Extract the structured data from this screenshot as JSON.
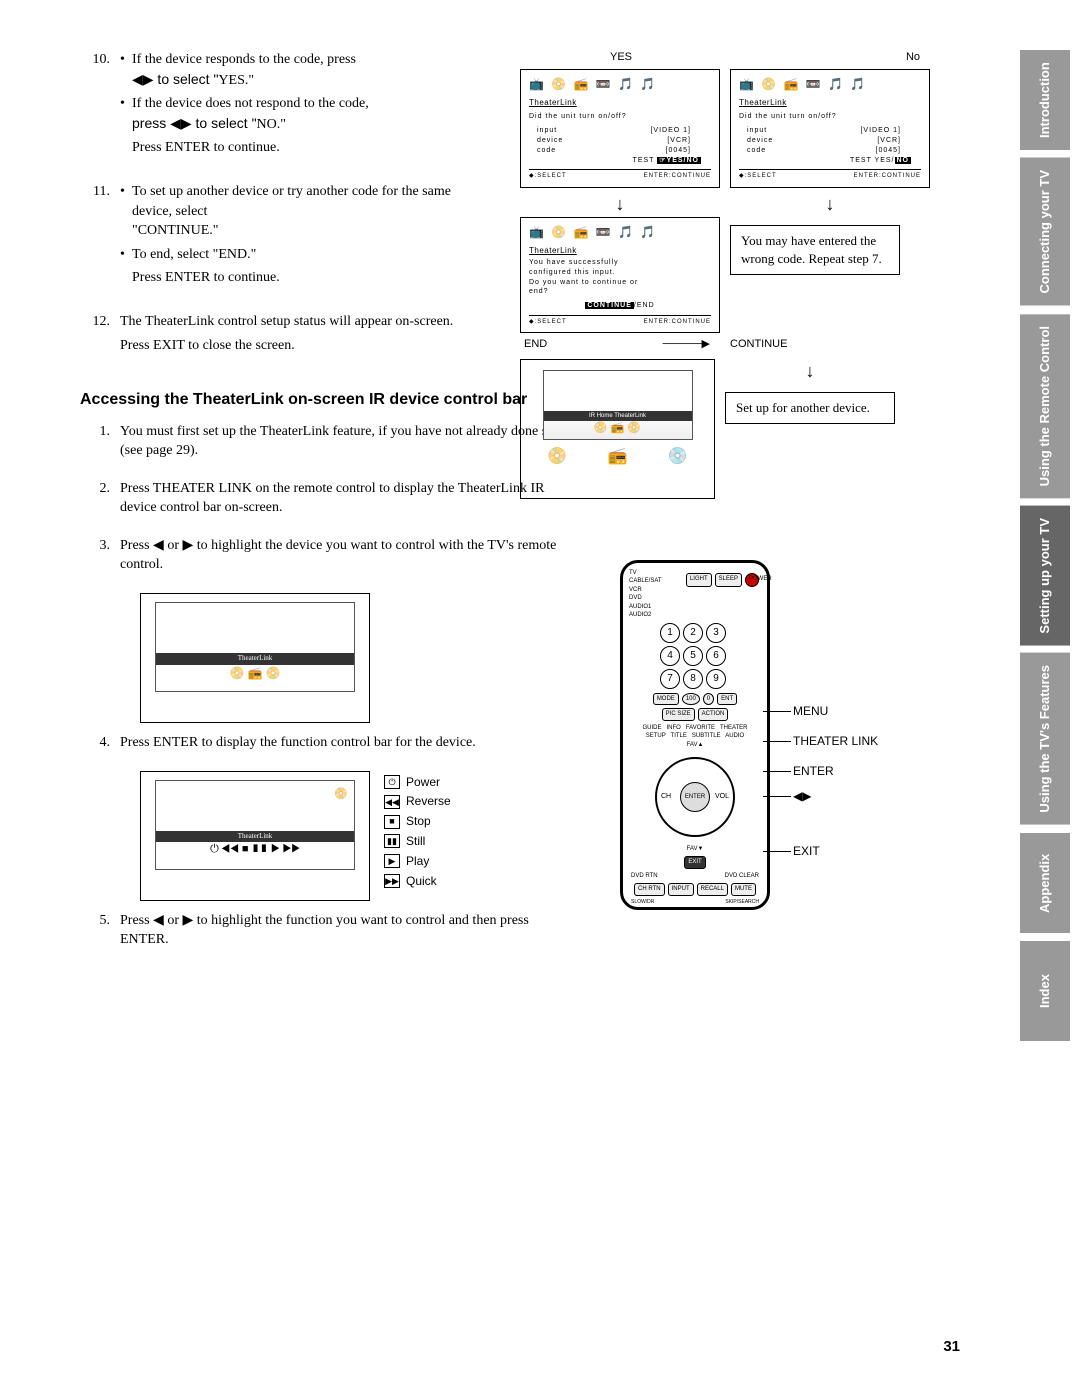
{
  "tabs": [
    "Introduction",
    "Connecting your TV",
    "Using the Remote Control",
    "Setting up your TV",
    "Using the TV's Features",
    "Appendix",
    "Index"
  ],
  "active_tab_index": 3,
  "step10": {
    "num": "10.",
    "a": "If  the device responds to the code, press",
    "a2_prefix": "◀▶ to select \"",
    "a2_val": "YES",
    "a2_suffix": ".\"",
    "b": "If the device does not respond to the code,",
    "b2_prefix": "press ◀▶ to select \"",
    "b2_val": "NO",
    "b2_suffix": ".\"",
    "c": "Press ENTER to continue."
  },
  "step11": {
    "num": "11.",
    "a": "To set up another device or try another code for the same device, select",
    "a2": "\"CONTINUE.\"",
    "b": "To end, select \"END.\"",
    "c": "Press ENTER to continue."
  },
  "step12": {
    "num": "12.",
    "a": "The TheaterLink control setup status will appear on-screen.",
    "b": "Press EXIT to close the screen."
  },
  "yes_label": "YES",
  "no_label": "No",
  "screen_common": {
    "icons": "📺 📀 📻 📼 🎵 🎵",
    "title": "TheaterLink",
    "question": "Did the unit turn on/off?",
    "kv_input_k": "input",
    "kv_input_v": "[VIDEO 1]",
    "kv_device_k": "device",
    "kv_device_v": "[VCR]",
    "kv_code_k": "code",
    "kv_code_v": "[0045]",
    "test": "TEST",
    "footer_select": "◆:SELECT",
    "footer_enter": "ENTER:CONTINUE"
  },
  "screen_yes_testline": "☞YES/NO",
  "screen_no_testline": "YES/NO",
  "screen_confirm": {
    "msg1": "You have successfully",
    "msg2": "configured this input.",
    "msg3": "Do you want to continue or",
    "msg4": "end?",
    "cont": "CONTINUE",
    "end": "/END"
  },
  "note_wrong": "You may have entered the wrong code. Repeat step 7.",
  "note_another": "Set up for another device.",
  "end_label": "END",
  "continue_label": "CONTINUE",
  "tv_bar_title": "IR Home TheaterLink",
  "heading": "Accessing the TheaterLink on-screen IR device control bar",
  "acc_steps": {
    "s1": {
      "num": "1.",
      "text": "You must first set up the TheaterLink feature, if you have not already done so (see page 29)."
    },
    "s2": {
      "num": "2.",
      "text": "Press THEATER LINK on the remote control to display the TheaterLink IR device control bar on-screen."
    },
    "s3": {
      "num": "3.",
      "text": "Press ◀ or ▶ to highlight the device you want to control with the TV's remote control."
    },
    "s4": {
      "num": "4.",
      "text": "Press ENTER to display the function control bar for the device."
    },
    "s5": {
      "num": "5.",
      "text": "Press ◀ or ▶ to highlight the function you want to control and then press ENTER."
    }
  },
  "tv_inner_label": "TheaterLink",
  "legend": {
    "power": "Power",
    "reverse": "Reverse",
    "stop": "Stop",
    "still": "Still",
    "play": "Play",
    "quick": "Quick"
  },
  "remote_callouts": {
    "menu": "MENU",
    "theater": "THEATER LINK",
    "enter": "ENTER",
    "arrows": "◀▶",
    "exit": "EXIT"
  },
  "remote_side_labels": {
    "tv": "TV",
    "cable": "CABLE/SAT",
    "vcr": "VCR",
    "dvd": "DVD",
    "audio1": "AUDIO1",
    "audio2": "AUDIO2",
    "mode": "MODE",
    "picsize": "PIC SIZE",
    "action": "ACTION",
    "light": "LIGHT",
    "sleep": "SLEEP",
    "power": "POWER",
    "ent": "ENT",
    "exit": "EXIT",
    "chrtn": "CH RTN",
    "input": "INPUT",
    "recall": "RECALL",
    "mute": "MUTE",
    "slow": "SLOW/DR",
    "skip": "SKIP/SEARCH",
    "dvdrtn": "DVD RTN",
    "dvdclear": "DVD CLEAR",
    "fav_up": "FAV▲",
    "fav_dn": "FAV▼",
    "ch": "CH",
    "vol": "VOL"
  },
  "page_number": "31"
}
